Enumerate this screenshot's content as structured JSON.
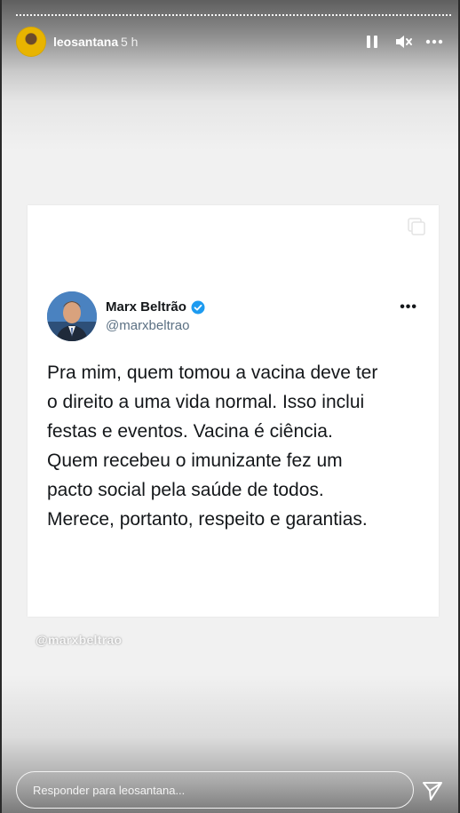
{
  "story": {
    "username": "leosantana",
    "time_ago": "5 h"
  },
  "tweet": {
    "author_name": "Marx Beltrão",
    "handle": "@marxbeltrao",
    "more": "•••",
    "text": "Pra mim, quem tomou a vacina deve ter\no direito a uma vida normal. Isso inclui\nfestas e eventos. Vacina é ciência.\nQuem recebeu o imunizante fez um\npacto social pela saúde de todos.\nMerece, portanto, respeito e garantias."
  },
  "mention_sticker": "@marxbeltrao",
  "reply": {
    "placeholder": "Responder para leosantana..."
  },
  "icons": {
    "pause": "pause-icon",
    "mute": "speaker-muted-icon",
    "more": "more-horizontal-icon",
    "copy": "copy-icon",
    "verified": "verified-badge-icon",
    "send": "send-icon"
  },
  "colors": {
    "verified_blue": "#1d9bf0",
    "text_primary": "#14171a",
    "text_secondary": "#5b7083"
  }
}
